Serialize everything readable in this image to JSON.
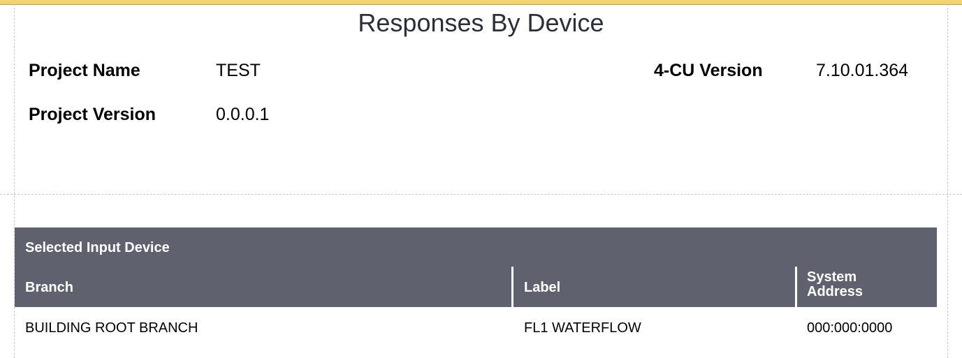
{
  "report": {
    "title": "Responses By Device"
  },
  "project": {
    "name_label": "Project Name",
    "name_value": "TEST",
    "version_label": "Project Version",
    "version_value": "0.0.0.1",
    "cu_version_label": "4-CU Version",
    "cu_version_value": "7.10.01.364"
  },
  "table": {
    "section_header": "Selected Input Device",
    "columns": [
      "Branch",
      "Label",
      "System Address"
    ],
    "rows": [
      [
        "BUILDING ROOT BRANCH",
        "FL1 WATERFLOW",
        "000:000:0000"
      ]
    ]
  },
  "colors": {
    "header_bar": "#5f626e",
    "title_text": "#2a2f3a",
    "top_border": "#f3d36e"
  }
}
